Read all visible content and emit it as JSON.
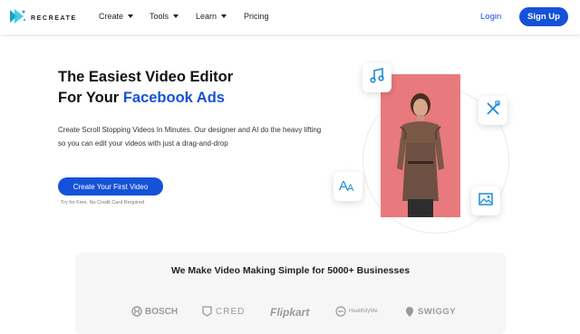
{
  "nav": {
    "logo_text": "RECREATE",
    "menu": [
      {
        "label": "Create",
        "has_dropdown": true
      },
      {
        "label": "Tools",
        "has_dropdown": true
      },
      {
        "label": "Learn",
        "has_dropdown": true
      },
      {
        "label": "Pricing",
        "has_dropdown": false
      }
    ],
    "login_label": "Login",
    "signup_label": "Sign Up"
  },
  "hero": {
    "title_line1": "The Easiest Video Editor",
    "title_line2_prefix": "For Your ",
    "title_line2_highlight": "Facebook Ads",
    "description": "Create Scroll Stopping Videos In Minutes. Our designer and AI do the heavy lifting so you can edit your videos with just a drag-and-drop",
    "cta_label": "Create Your First Video",
    "cta_note": "Try for Free. No Credit Card Required",
    "icons": [
      "music-note-icon",
      "magic-wand-icon",
      "text-icon",
      "image-icon"
    ]
  },
  "trust": {
    "title": "We Make Video Making Simple for 5000+ Businesses",
    "brands": [
      "BOSCH",
      "CRED",
      "Flipkart",
      "HealthifyMe",
      "SWIGGY"
    ]
  },
  "colors": {
    "accent": "#1552d9",
    "video_bg": "#e8797c",
    "trust_bg": "#f6f6f6"
  }
}
